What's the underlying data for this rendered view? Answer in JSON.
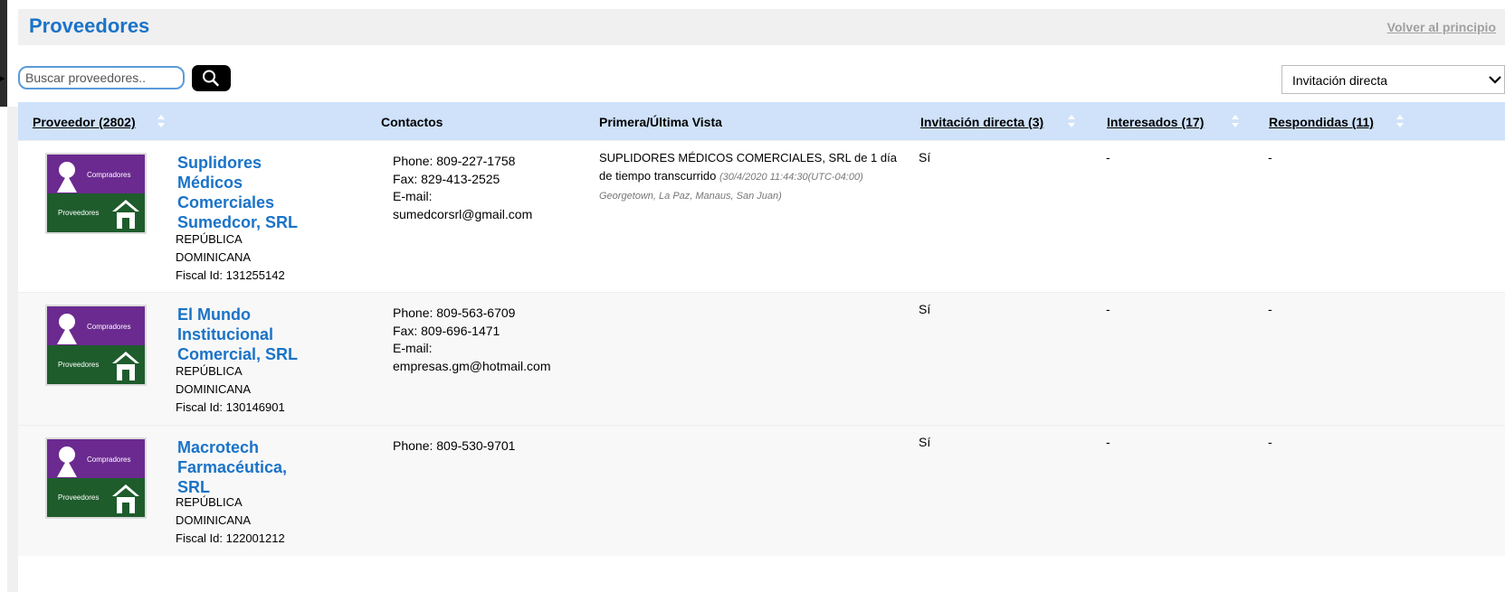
{
  "header": {
    "title": "Proveedores",
    "back_link": "Volver al principio"
  },
  "search": {
    "placeholder": "Buscar proveedores..",
    "icon": "search-icon"
  },
  "filter": {
    "selected": "Invitación directa"
  },
  "columns": {
    "supplier": "Proveedor (2802)",
    "contacts": "Contactos",
    "view": "Primera/Última Vista",
    "invitation": "Invitación directa (3)",
    "interested": "Interesados (17)",
    "responded": "Respondidas (11)"
  },
  "logo": {
    "top_label": "Compradores",
    "bottom_label": "Proveedores"
  },
  "rows": [
    {
      "name_lines": [
        "Suplidores",
        "Médicos",
        "Comerciales",
        "Sumedcor, SRL"
      ],
      "country_lines": [
        "REPÚBLICA",
        "DOMINICANA"
      ],
      "fiscal": "Fiscal Id: 131255142",
      "contacts": [
        "Phone: 809-227-1758",
        "Fax: 829-413-2525",
        "E-mail:",
        "sumedcorsrl@gmail.com"
      ],
      "view_main": "SUPLIDORES MÉDICOS COMERCIALES, SRL de 1 día de tiempo transcurrido",
      "view_detail": "(30/4/2020 11:44:30(UTC-04:00) Georgetown, La Paz, Manaus, San Juan)",
      "invitation": "Sí",
      "interested": "-",
      "responded": "-"
    },
    {
      "name_lines": [
        "El Mundo",
        "Institucional",
        "Comercial, SRL"
      ],
      "country_lines": [
        "REPÚBLICA",
        "DOMINICANA"
      ],
      "fiscal": "Fiscal Id: 130146901",
      "contacts": [
        "Phone: 809-563-6709",
        "Fax: 809-696-1471",
        "E-mail:",
        "empresas.gm@hotmail.com"
      ],
      "view_main": "",
      "view_detail": "",
      "invitation": "Sí",
      "interested": "-",
      "responded": "-"
    },
    {
      "name_lines": [
        "Macrotech",
        "Farmacéutica,",
        "SRL"
      ],
      "country_lines": [
        "REPÚBLICA",
        "DOMINICANA"
      ],
      "fiscal": "Fiscal Id: 122001212",
      "contacts": [
        "Phone: 809-530-9701"
      ],
      "view_main": "",
      "view_detail": "",
      "invitation": "Sí",
      "interested": "-",
      "responded": "-"
    }
  ],
  "colors": {
    "accent": "#1a73c8",
    "header_bg": "#cfe2fa",
    "logo_purple": "#6b2a90",
    "logo_green": "#1e5c2c"
  }
}
